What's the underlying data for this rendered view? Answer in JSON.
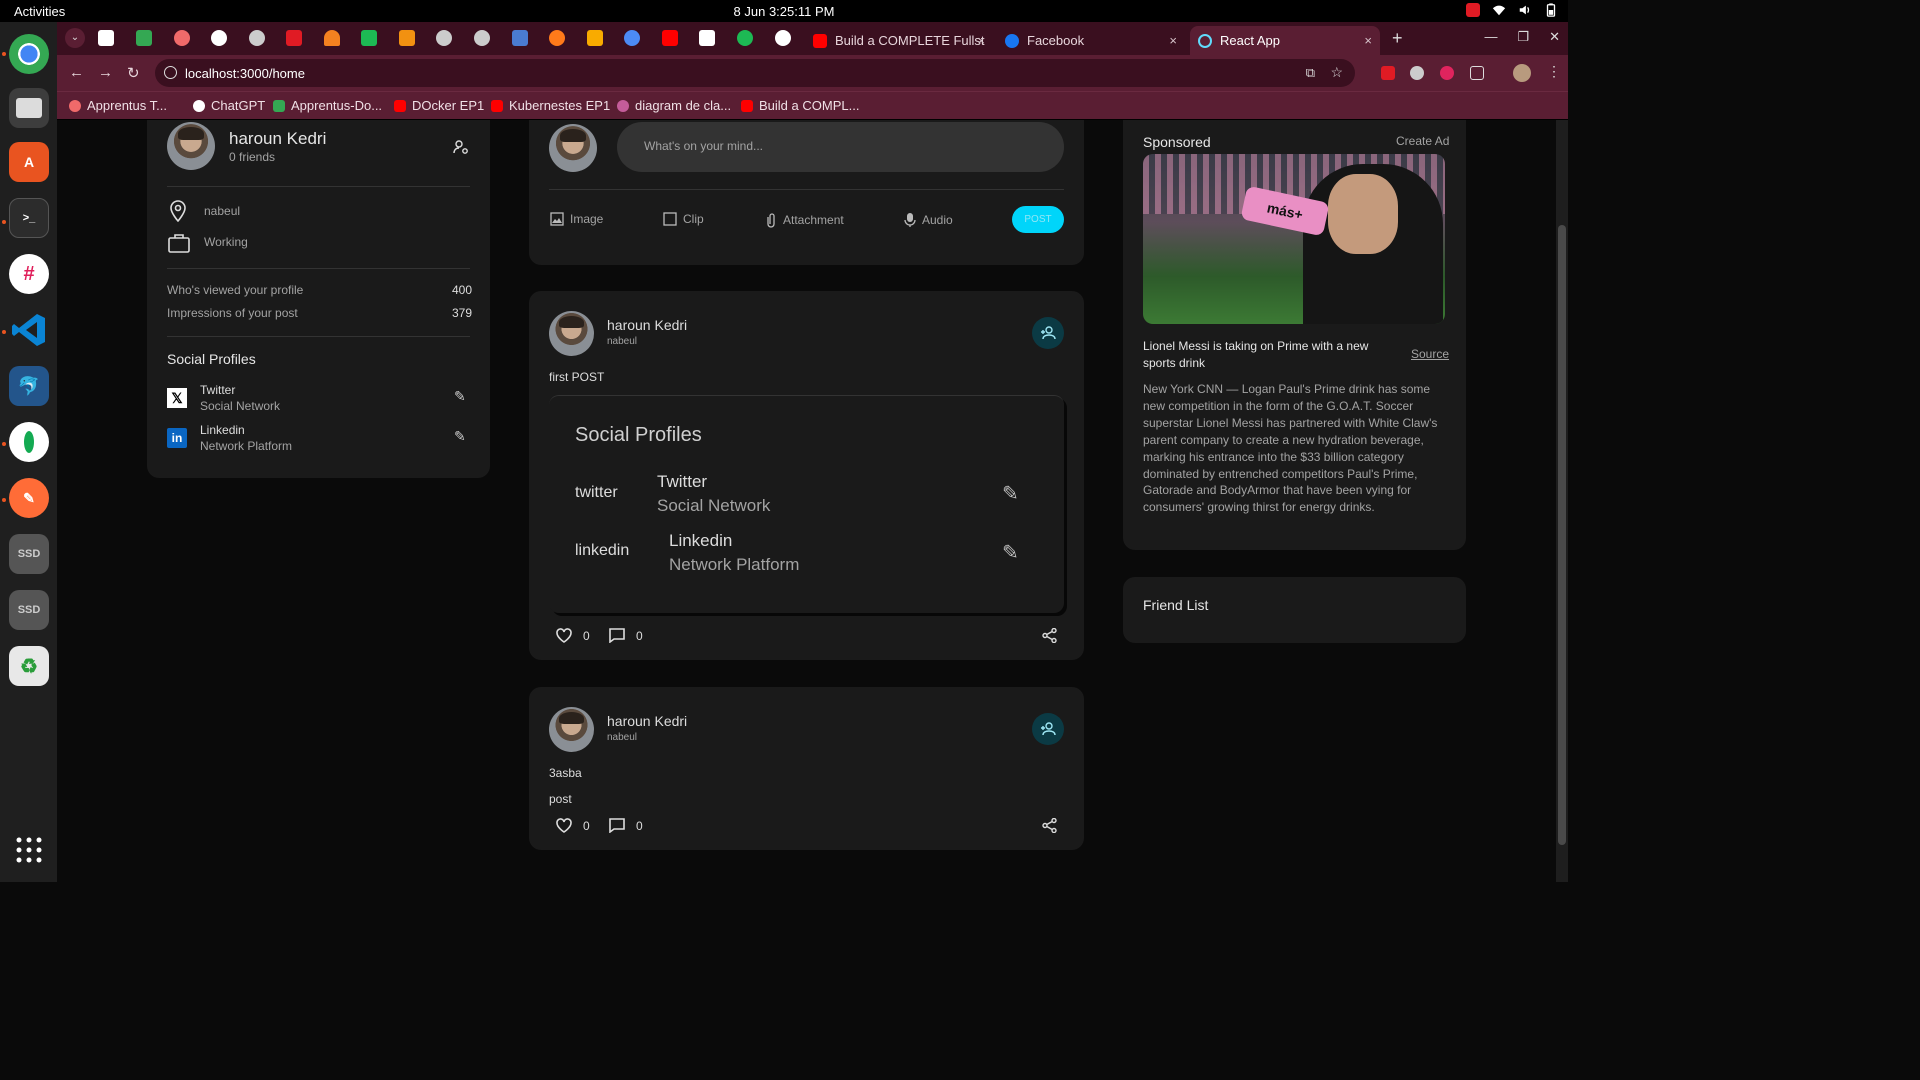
{
  "system": {
    "activities": "Activities",
    "clock": "8 Jun  3:25:11 PM"
  },
  "browser": {
    "tabs": [
      {
        "label": "Build a COMPLETE Fullst",
        "close": "×"
      },
      {
        "label": "Facebook",
        "close": "×"
      },
      {
        "label": "React App",
        "close": "×"
      }
    ],
    "new_tab": "+",
    "url": "localhost:3000/home",
    "bookmarks": [
      "Apprentus T...",
      "ChatGPT",
      "Apprentus-Do...",
      "DOcker EP1",
      "Kubernestes EP1",
      "diagram de cla...",
      "Build a COMPL..."
    ]
  },
  "profile": {
    "name": "haroun Kedri",
    "friends": "0 friends",
    "location": "nabeul",
    "occupation": "Working",
    "viewed_label": "Who's viewed your profile",
    "viewed_value": "400",
    "impressions_label": "Impressions of your post",
    "impressions_value": "379",
    "social_title": "Social Profiles",
    "social": [
      {
        "name": "Twitter",
        "type": "Social Network"
      },
      {
        "name": "Linkedin",
        "type": "Network Platform"
      }
    ]
  },
  "composer": {
    "placeholder": "What's on your mind...",
    "actions": [
      "Image",
      "Clip",
      "Attachment",
      "Audio"
    ],
    "post_button": "POST"
  },
  "posts": [
    {
      "author": "haroun Kedri",
      "location": "nabeul",
      "text": "first POST",
      "embed": {
        "title": "Social Profiles",
        "items": [
          {
            "alt": "twitter",
            "name": "Twitter",
            "type": "Social Network"
          },
          {
            "alt": "linkedin",
            "name": "Linkedin",
            "type": "Network Platform"
          }
        ]
      },
      "likes": "0",
      "comments": "0"
    },
    {
      "author": "haroun Kedri",
      "location": "nabeul",
      "text": "3asba",
      "image_alt": "post",
      "likes": "0",
      "comments": "0"
    }
  ],
  "ad": {
    "label": "Sponsored",
    "create": "Create Ad",
    "image_text": "más+",
    "headline": "Lionel Messi is taking on Prime with a new sports drink",
    "source": "Source",
    "body": "New York CNN — Logan Paul's Prime drink has some new competition in the form of the G.O.A.T. Soccer superstar Lionel Messi has partnered with White Claw's parent company to create a new hydration beverage, marking his entrance into the $33 billion category dominated by entrenched competitors Paul's Prime, Gatorade and BodyArmor that have been vying for consumers' growing thirst for energy drinks."
  },
  "friends": {
    "title": "Friend List"
  },
  "colors": {
    "accent": "#00d5fa",
    "card": "#1a1a1a",
    "background": "#0a0a0a",
    "chrome_frame": "#3a0f1f",
    "chrome_toolbar": "#5a1e33"
  }
}
